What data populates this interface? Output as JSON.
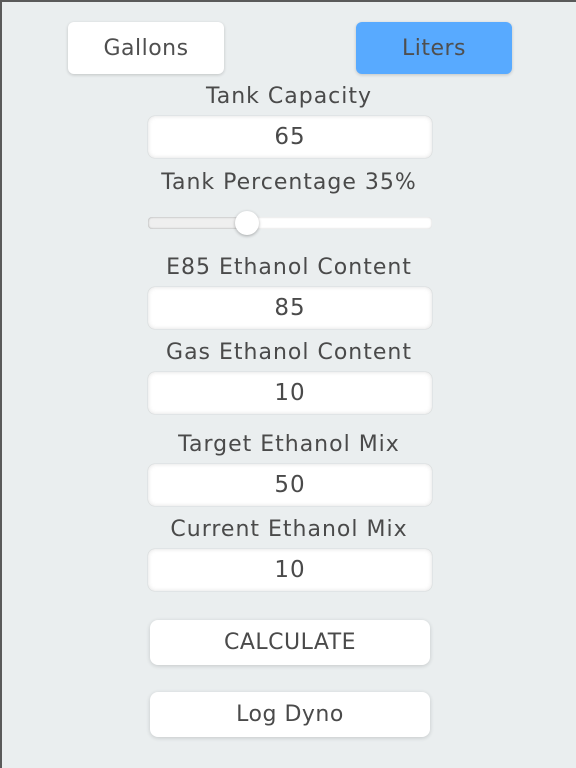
{
  "units": {
    "gallons_label": "Gallons",
    "liters_label": "Liters",
    "selected": "Liters",
    "selected_color": "#58aaff"
  },
  "tank_capacity": {
    "label": "Tank Capacity",
    "value": "65"
  },
  "tank_percentage": {
    "label": "Tank Percentage 35%",
    "value": 35,
    "min": 0,
    "max": 100
  },
  "e85_ethanol_content": {
    "label": "E85 Ethanol Content",
    "value": "85"
  },
  "gas_ethanol_content": {
    "label": "Gas Ethanol Content",
    "value": "10"
  },
  "target_ethanol_mix": {
    "label": "Target Ethanol Mix",
    "value": "50"
  },
  "current_ethanol_mix": {
    "label": "Current Ethanol Mix",
    "value": "10"
  },
  "actions": {
    "calculate_label": "CALCULATE",
    "log_dyno_label": "Log Dyno"
  }
}
